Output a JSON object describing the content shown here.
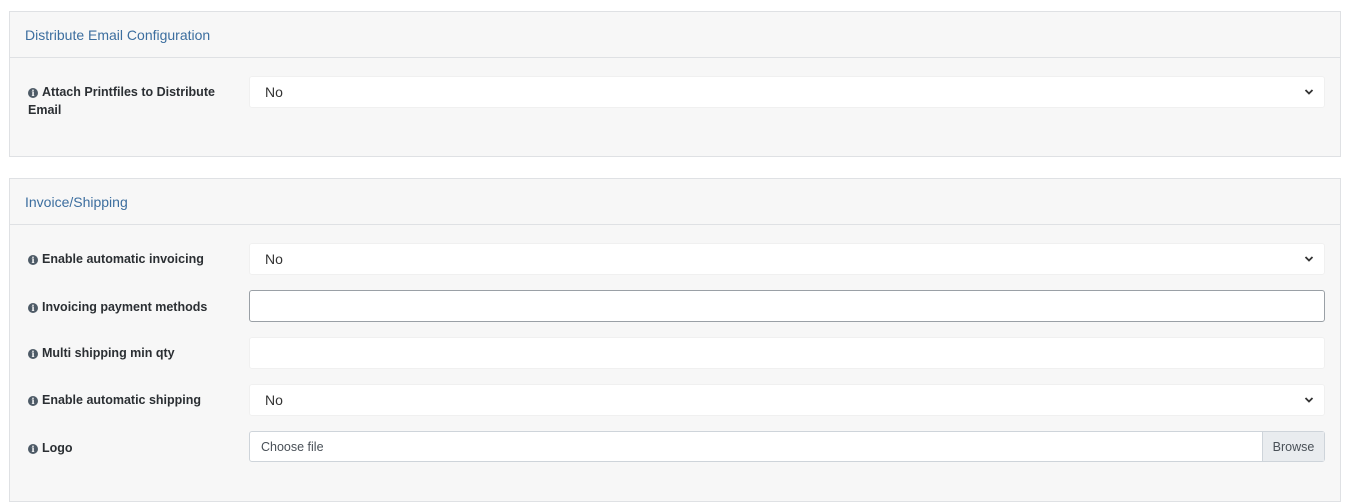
{
  "sections": [
    {
      "title": "Distribute Email Configuration",
      "fields": [
        {
          "label": "Attach Printfiles to Distribute Email",
          "type": "select",
          "value": "No"
        }
      ]
    },
    {
      "title": "Invoice/Shipping",
      "fields": [
        {
          "label": "Enable automatic invoicing",
          "type": "select",
          "value": "No"
        },
        {
          "label": "Invoicing payment methods",
          "type": "text",
          "value": ""
        },
        {
          "label": "Multi shipping min qty",
          "type": "text",
          "value": ""
        },
        {
          "label": "Enable automatic shipping",
          "type": "select",
          "value": "No"
        },
        {
          "label": "Logo",
          "type": "file",
          "value": "Choose file",
          "button": "Browse"
        }
      ]
    }
  ],
  "icons": {
    "info": "info-circle-icon",
    "select_arrow": "chevron-down-icon"
  }
}
